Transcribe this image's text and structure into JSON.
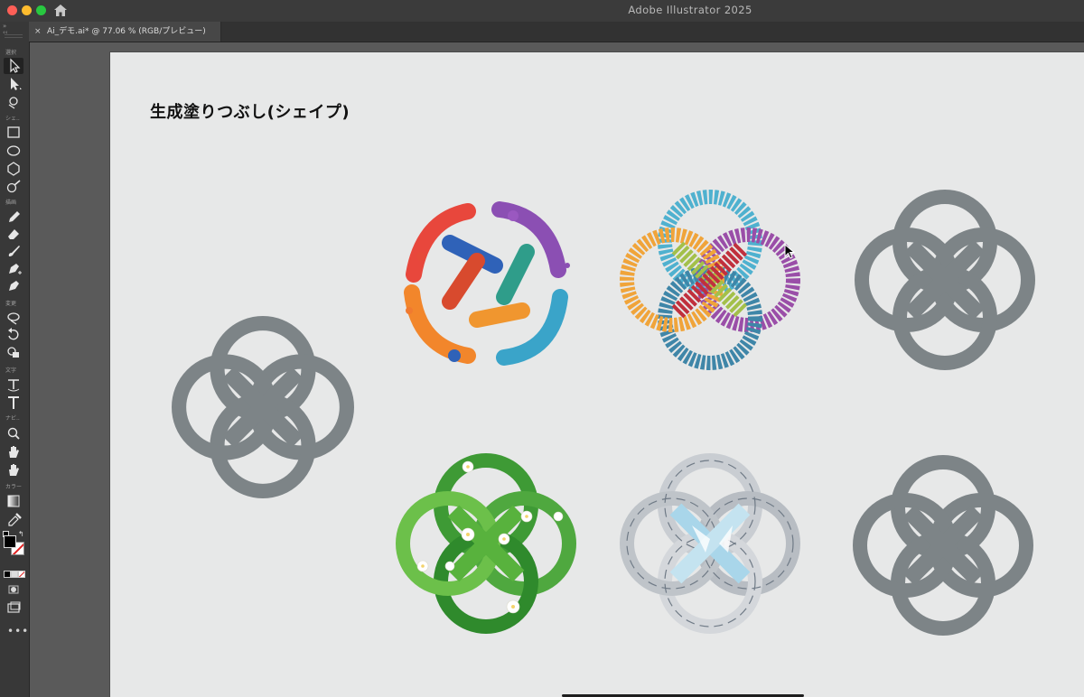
{
  "window": {
    "app_title": "Adobe Illustrator 2025",
    "home_icon": "home-icon"
  },
  "document_tab": {
    "close_glyph": "×",
    "label": "Ai_デモ.ai* @ 77.06 % (RGB/プレビュー)"
  },
  "tool_panel": {
    "categories": [
      "選択",
      "シェ..",
      "描画",
      "変更",
      "文字",
      "ナビ..",
      "カラー"
    ],
    "tools": [
      "selection-tool",
      "direct-selection-tool",
      "magic-wand-tool",
      "rectangle-tool",
      "ellipse-tool",
      "polygon-tool",
      "shaper-tool",
      "pencil-tool",
      "eraser-tool",
      "paintbrush-tool",
      "pen-tool",
      "curvature-tool",
      "lasso-tool",
      "rotate-tool",
      "shape-builder-tool",
      "type-on-path-tool",
      "type-tool",
      "zoom-tool",
      "hand-tool",
      "rotate-view-tool",
      "gradient-tool",
      "eyedropper-tool"
    ],
    "fill_color": "#000000",
    "stroke_color": "#ffffff",
    "more_glyph": "•••"
  },
  "artboard": {
    "heading": "生成塗りつぶし(シェイプ)",
    "source_shape_color": "#7d8487",
    "variants": [
      {
        "name": "paint-splash-knot",
        "colors": [
          "#e8473c",
          "#f2862b",
          "#2f62b8",
          "#2f9d8a",
          "#8b4fb3",
          "#3aa4c9"
        ]
      },
      {
        "name": "rope-knot",
        "colors": [
          "#4fb1cf",
          "#a3c04a",
          "#c0303d",
          "#9a4ea8",
          "#f0a43a",
          "#e3532f"
        ]
      },
      {
        "name": "gray-knot-top",
        "colors": [
          "#7d8487"
        ]
      },
      {
        "name": "leaf-flower-knot",
        "colors": [
          "#3e9a35",
          "#6cc04a",
          "#ffffff",
          "#f3d36b"
        ]
      },
      {
        "name": "crystal-knot",
        "colors": [
          "#c9cdd2",
          "#ffffff",
          "#a9d6ea",
          "#6f7a86"
        ]
      },
      {
        "name": "gray-knot-bottom",
        "colors": [
          "#7d8487"
        ]
      }
    ]
  }
}
